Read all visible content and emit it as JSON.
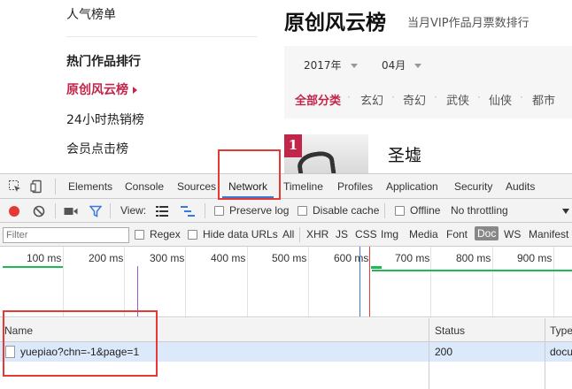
{
  "site": {
    "sidebar": {
      "items": [
        {
          "label": "人气榜单"
        },
        {
          "label": "热门作品排行"
        },
        {
          "label": "原创风云榜"
        },
        {
          "label": "24小时热销榜"
        },
        {
          "label": "会员点击榜"
        }
      ]
    },
    "ranking": {
      "title": "原创风云榜",
      "subtitle": "当月VIP作品月票数排行",
      "year_select": "2017年",
      "month_select": "04月",
      "categories": [
        "全部分类",
        "玄幻",
        "奇幻",
        "武侠",
        "仙侠",
        "都市"
      ],
      "first_book": {
        "rank": "1",
        "title": "圣墟"
      }
    }
  },
  "devtools": {
    "tabs": [
      "Elements",
      "Console",
      "Sources",
      "Network",
      "Timeline",
      "Profiles",
      "Application",
      "Security",
      "Audits"
    ],
    "active_tab": "Network",
    "toolbar": {
      "view_label": "View:",
      "preserve_log": "Preserve log",
      "disable_cache": "Disable cache",
      "offline": "Offline",
      "throttling": "No throttling"
    },
    "filter": {
      "placeholder": "Filter",
      "regex": "Regex",
      "hide_data_urls": "Hide data URLs",
      "types": [
        "All",
        "XHR",
        "JS",
        "CSS",
        "Img",
        "Media",
        "Font",
        "Doc",
        "WS",
        "Manifest"
      ],
      "selected_type": "Doc"
    },
    "timeline": {
      "ticks": [
        "100 ms",
        "200 ms",
        "300 ms",
        "400 ms",
        "500 ms",
        "600 ms",
        "700 ms",
        "800 ms",
        "900 ms"
      ]
    },
    "table": {
      "columns": [
        "Name",
        "Status",
        "Type"
      ],
      "rows": [
        {
          "name": "yuepiao?chn=-1&page=1",
          "status": "200",
          "type": "docu"
        }
      ]
    },
    "colors": {
      "accent": "#3879d9",
      "record": "#e53935",
      "annotation": "#e53935",
      "brand": "#c3244a"
    }
  }
}
